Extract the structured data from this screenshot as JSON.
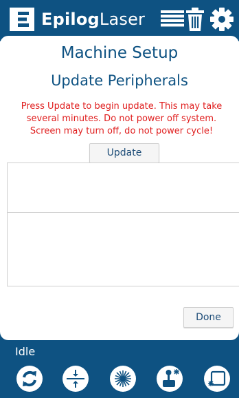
{
  "header": {
    "brand_bold": "Epilog",
    "brand_light": "Laser",
    "icons": [
      "list-icon",
      "trash-icon",
      "gear-icon"
    ]
  },
  "page": {
    "title": "Machine Setup",
    "subtitle": "Update Peripherals",
    "warning_lines": [
      "Press Update to begin update. This may take",
      "several minutes. Do not power off system.",
      "Screen may turn off, do not power cycle!"
    ]
  },
  "buttons": {
    "update": "Update",
    "done": "Done"
  },
  "footer": {
    "status": "Idle",
    "actions": [
      "refresh-icon",
      "focus-icon",
      "laser-icon",
      "joystick-icon",
      "window-icon"
    ]
  },
  "colors": {
    "brand": "#0e5282",
    "warning": "#e01e1e"
  }
}
